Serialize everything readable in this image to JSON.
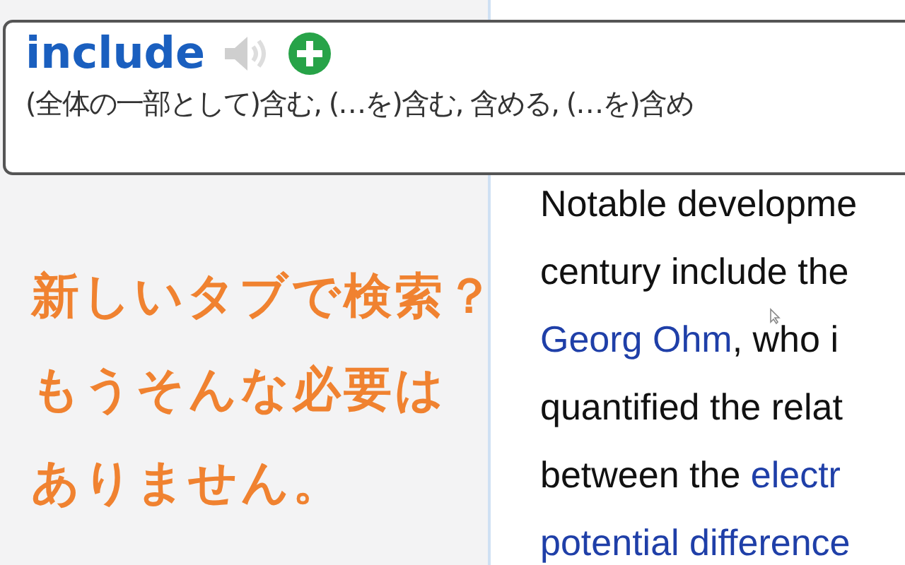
{
  "popup": {
    "word": "include",
    "definition": "(全体の一部として)含む, (…を)含む, 含める, (…を)含め"
  },
  "promo": {
    "lines": [
      "新しいタブで検索？",
      "もうそんな必要は",
      "ありません。"
    ]
  },
  "article": {
    "lines": [
      [
        {
          "kind": "text",
          "text": "Notable developme"
        }
      ],
      [
        {
          "kind": "text",
          "text": "century include the"
        }
      ],
      [
        {
          "kind": "link",
          "text": "Georg Ohm"
        },
        {
          "kind": "text",
          "text": ", who i"
        }
      ],
      [
        {
          "kind": "text",
          "text": "quantified the relat"
        }
      ],
      [
        {
          "kind": "text",
          "text": "between the "
        },
        {
          "kind": "link",
          "text": "electr"
        }
      ],
      [
        {
          "kind": "link",
          "text": "potential difference"
        }
      ]
    ]
  }
}
